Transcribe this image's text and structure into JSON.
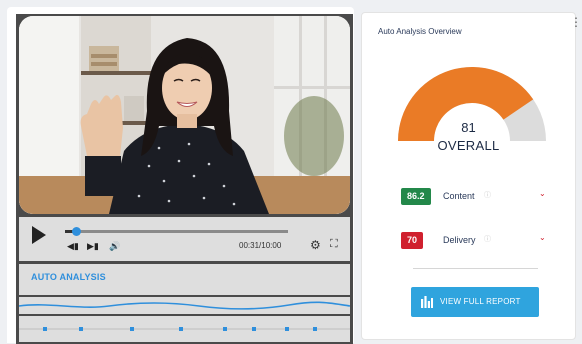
{
  "player": {
    "time": "00:31/10:00",
    "progress_fraction": 0.05,
    "analysis_header": "AUTO ANALYSIS",
    "marker_count": 8
  },
  "analysis": {
    "title": "Auto Analysis Overview",
    "overall_score": "81",
    "overall_label": "OVERALL",
    "gauge_fraction": 0.81,
    "gauge_color": "#ea7b26",
    "gauge_track_color": "#dcdcdc",
    "metrics": [
      {
        "value": "86.2",
        "label": "Content",
        "color": "#23884a"
      },
      {
        "value": "70",
        "label": "Delivery",
        "color": "#d0202e"
      }
    ],
    "report_button": "VIEW FULL REPORT"
  },
  "colors": {
    "accent": "#2f8fdc",
    "button": "#2fa4de"
  },
  "icons": [
    "play-icon",
    "skip-back-icon",
    "skip-forward-icon",
    "volume-icon",
    "gear-icon",
    "fullscreen-icon",
    "info-icon",
    "chevron-down-icon",
    "bar-chart-icon",
    "kebab-menu-icon"
  ]
}
